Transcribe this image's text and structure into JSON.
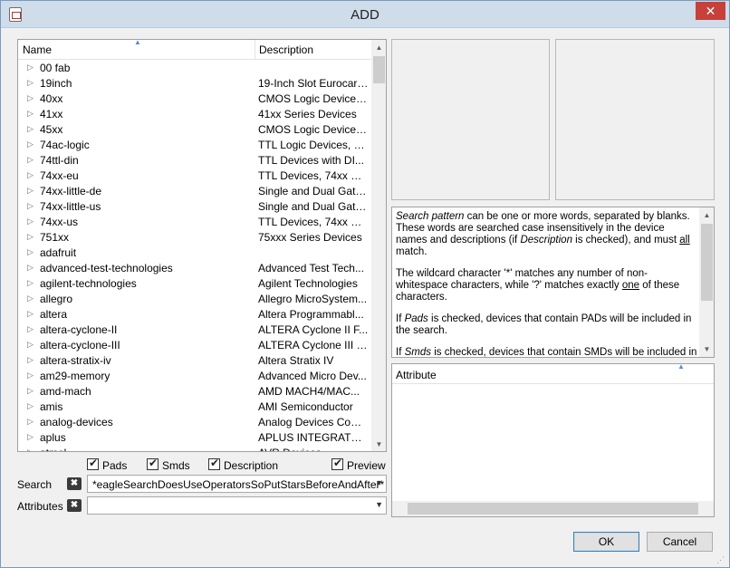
{
  "window": {
    "title": "ADD",
    "close_glyph": "✕"
  },
  "tree": {
    "col_name": "Name",
    "col_desc": "Description",
    "sort_glyph": "▲",
    "rows": [
      {
        "name": "00 fab",
        "desc": ""
      },
      {
        "name": "19inch",
        "desc": "19-Inch Slot Eurocards"
      },
      {
        "name": "40xx",
        "desc": "CMOS Logic Devices..."
      },
      {
        "name": "41xx",
        "desc": "41xx Series Devices"
      },
      {
        "name": "45xx",
        "desc": "CMOS Logic Devices..."
      },
      {
        "name": "74ac-logic",
        "desc": "TTL Logic Devices, 7..."
      },
      {
        "name": "74ttl-din",
        "desc": "TTL Devices with DI..."
      },
      {
        "name": "74xx-eu",
        "desc": "TTL Devices, 74xx Ser..."
      },
      {
        "name": "74xx-little-de",
        "desc": "Single and Dual Gate..."
      },
      {
        "name": "74xx-little-us",
        "desc": "Single and Dual Gate..."
      },
      {
        "name": "74xx-us",
        "desc": "TTL Devices, 74xx Ser..."
      },
      {
        "name": "751xx",
        "desc": "75xxx Series Devices"
      },
      {
        "name": "adafruit",
        "desc": ""
      },
      {
        "name": "advanced-test-technologies",
        "desc": "Advanced Test Tech..."
      },
      {
        "name": "agilent-technologies",
        "desc": "Agilent Technologies"
      },
      {
        "name": "allegro",
        "desc": "Allegro MicroSystem..."
      },
      {
        "name": "altera",
        "desc": "Altera Programmabl..."
      },
      {
        "name": "altera-cyclone-II",
        "desc": "ALTERA Cyclone II F..."
      },
      {
        "name": "altera-cyclone-III",
        "desc": "ALTERA Cyclone III F..."
      },
      {
        "name": "altera-stratix-iv",
        "desc": "Altera Stratix IV"
      },
      {
        "name": "am29-memory",
        "desc": "Advanced Micro Dev..."
      },
      {
        "name": "amd-mach",
        "desc": "AMD MACH4/MAC..."
      },
      {
        "name": "amis",
        "desc": "AMI Semiconductor"
      },
      {
        "name": "analog-devices",
        "desc": "Analog Devices Com..."
      },
      {
        "name": "aplus",
        "desc": "APLUS INTEGRATED ..."
      },
      {
        "name": "atmel",
        "desc": "AVR Devices"
      }
    ],
    "expander_glyph": "▷",
    "scroll_up_glyph": "▲",
    "scroll_down_glyph": "▼"
  },
  "filters": {
    "pads": "Pads",
    "smds": "Smds",
    "description": "Description",
    "preview": "Preview"
  },
  "search": {
    "label": "Search",
    "clear_glyph": "✖",
    "value": "*eagleSearchDoesUseOperatorsSoPutStarsBeforeAndAfter*",
    "dropdown_glyph": "▼"
  },
  "attributes": {
    "label": "Attributes",
    "clear_glyph": "✖",
    "value": "",
    "dropdown_glyph": "▼"
  },
  "help": {
    "p1_a": "Search pattern",
    "p1_b": " can be one or more words, separated by blanks. These words are searched case insensitively in the device names and descriptions (if ",
    "p1_c": "Description",
    "p1_d": " is checked), and must ",
    "p1_e": "all",
    "p1_f": " match.",
    "p2_a": "The wildcard character '*' matches any number of non-whitespace characters, while '?' matches exactly ",
    "p2_b": "one",
    "p2_c": " of these characters.",
    "p3_a": "If ",
    "p3_b": "Pads",
    "p3_c": " is checked, devices that contain PADs will be included in the search.",
    "p4_a": "If ",
    "p4_b": "Smds",
    "p4_c": " is checked, devices that contain SMDs will be included in the search."
  },
  "attr_table": {
    "col": "Attribute",
    "sort_glyph": "▲"
  },
  "buttons": {
    "ok": "OK",
    "cancel": "Cancel"
  },
  "colors": {
    "titlebar": "#cfdcea",
    "close": "#c7413b",
    "default_border": "#3c7fb1"
  }
}
